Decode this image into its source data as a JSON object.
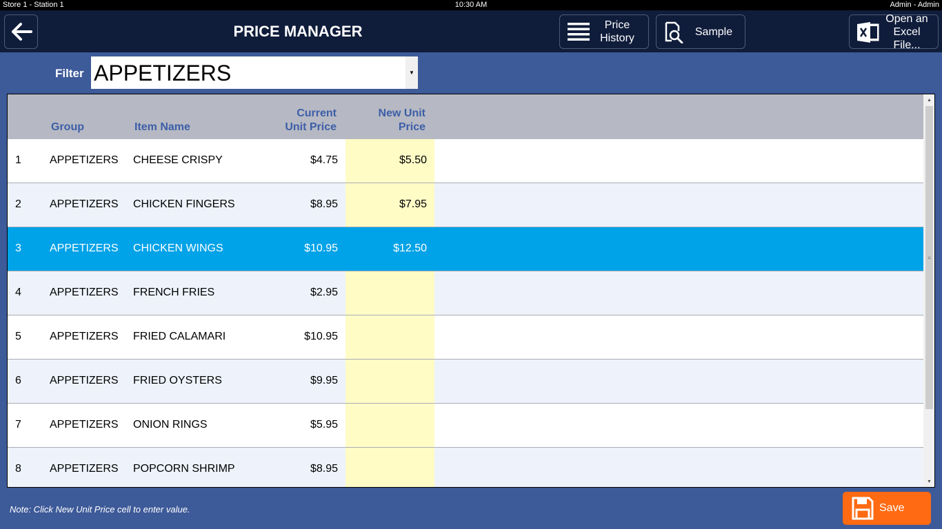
{
  "status_bar": {
    "left": "Store 1 - Station 1",
    "time": "10:30 AM",
    "user": "Admin - Admin"
  },
  "header": {
    "title": "PRICE MANAGER",
    "price_history_line1": "Price",
    "price_history_line2": "History",
    "sample_label": "Sample",
    "excel_line1": "Open an",
    "excel_line2": "Excel File..."
  },
  "filter": {
    "label": "Filter",
    "value": "APPETIZERS"
  },
  "table": {
    "columns": {
      "group": "Group",
      "item_name": "Item Name",
      "current_price_1": "Current",
      "current_price_2": "Unit Price",
      "new_price_1": "New Unit",
      "new_price_2": "Price"
    },
    "selected_row": 3,
    "rows": [
      {
        "num": "1",
        "group": "APPETIZERS",
        "name": "CHEESE CRISPY",
        "current": "$4.75",
        "new": "$5.50"
      },
      {
        "num": "2",
        "group": "APPETIZERS",
        "name": "CHICKEN FINGERS",
        "current": "$8.95",
        "new": "$7.95"
      },
      {
        "num": "3",
        "group": "APPETIZERS",
        "name": "CHICKEN WINGS",
        "current": "$10.95",
        "new": "$12.50"
      },
      {
        "num": "4",
        "group": "APPETIZERS",
        "name": "FRENCH FRIES",
        "current": "$2.95",
        "new": ""
      },
      {
        "num": "5",
        "group": "APPETIZERS",
        "name": "FRIED CALAMARI",
        "current": "$10.95",
        "new": ""
      },
      {
        "num": "6",
        "group": "APPETIZERS",
        "name": "FRIED OYSTERS",
        "current": "$9.95",
        "new": ""
      },
      {
        "num": "7",
        "group": "APPETIZERS",
        "name": "ONION RINGS",
        "current": "$5.95",
        "new": ""
      },
      {
        "num": "8",
        "group": "APPETIZERS",
        "name": "POPCORN SHRIMP",
        "current": "$8.95",
        "new": ""
      }
    ]
  },
  "footer": {
    "note": "Note: Click New Unit Price cell to enter value.",
    "save_label": "Save"
  },
  "colors": {
    "header_bg": "#0f1c3a",
    "page_bg": "#3d5a99",
    "selected_row": "#00a2e8",
    "new_price_cell": "#fffcc6",
    "save_button": "#ff6a12",
    "column_header_text": "#3d5ea8"
  },
  "icons": {
    "back": "arrow-left-icon",
    "history": "list-lines-icon",
    "sample": "document-search-icon",
    "excel": "excel-file-icon",
    "save": "floppy-disk-icon"
  }
}
